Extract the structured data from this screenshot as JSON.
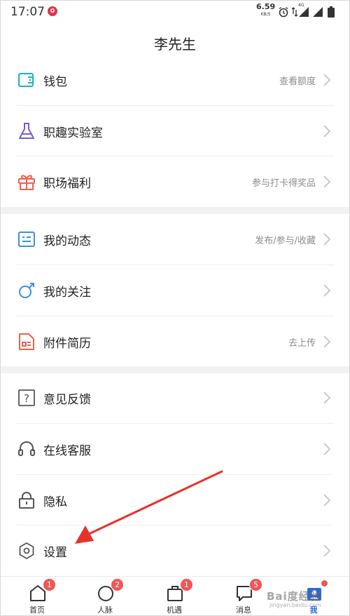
{
  "status_bar": {
    "time": "17:07",
    "net_speed": "6.59",
    "net_speed_unit": "KB/S",
    "network_label": "4G"
  },
  "header": {
    "title": "李先生"
  },
  "menu": {
    "group1": [
      {
        "label": "钱包",
        "hint": "查看额度",
        "icon": "wallet-icon",
        "color": "#1bb2c9"
      },
      {
        "label": "职趣实验室",
        "hint": "",
        "icon": "flask-icon",
        "color": "#7b5bd6"
      },
      {
        "label": "职场福利",
        "hint": "参与打卡得奖品",
        "icon": "gift-icon",
        "color": "#f0604b"
      }
    ],
    "group2": [
      {
        "label": "我的动态",
        "hint": "发布/参与/收藏",
        "icon": "feed-icon",
        "color": "#3e8fe0"
      },
      {
        "label": "我的关注",
        "hint": "",
        "icon": "follow-icon",
        "color": "#3e8fe0"
      },
      {
        "label": "附件简历",
        "hint": "去上传",
        "icon": "resume-icon",
        "color": "#f0604b"
      }
    ],
    "group3": [
      {
        "label": "意见反馈",
        "hint": "",
        "icon": "feedback-icon",
        "color": "#555555"
      },
      {
        "label": "在线客服",
        "hint": "",
        "icon": "headset-icon",
        "color": "#555555"
      },
      {
        "label": "隐私",
        "hint": "",
        "icon": "lock-icon",
        "color": "#555555"
      },
      {
        "label": "设置",
        "hint": "",
        "icon": "settings-icon",
        "color": "#555555"
      }
    ]
  },
  "tabbar": {
    "tabs": [
      {
        "label": "首页",
        "badge": "1",
        "icon": "home-icon"
      },
      {
        "label": "人脉",
        "badge": "2",
        "icon": "contacts-icon"
      },
      {
        "label": "机遇",
        "badge": "1",
        "icon": "briefcase-icon"
      },
      {
        "label": "消息",
        "badge": "5",
        "icon": "message-icon"
      },
      {
        "label": "我",
        "badge": "",
        "icon": "profile-icon",
        "active": true
      }
    ]
  },
  "watermark": {
    "text": "Bai度经验",
    "sub": "jingyan.baidu.com"
  },
  "colors": {
    "accent": "#2e6bd6",
    "badge": "#f25555",
    "arrow": "#e8312a"
  }
}
